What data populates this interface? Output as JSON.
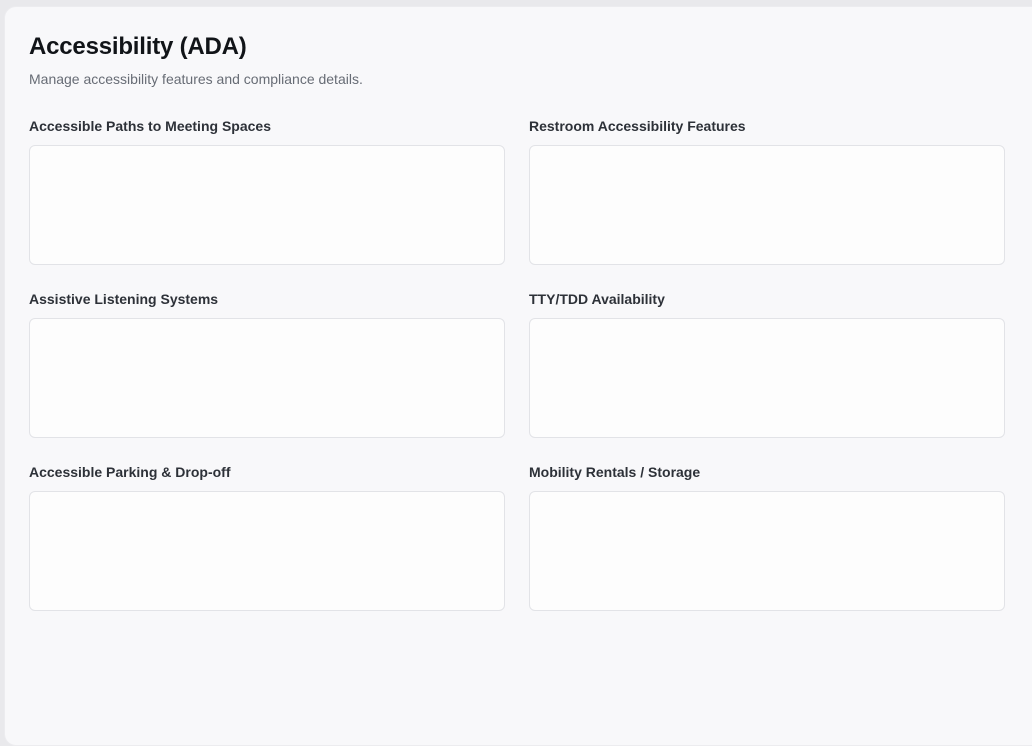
{
  "header": {
    "title": "Accessibility (ADA)",
    "subtitle": "Manage accessibility features and compliance details."
  },
  "fields": [
    {
      "label": "Accessible Paths to Meeting Spaces",
      "value": ""
    },
    {
      "label": "Restroom Accessibility Features",
      "value": ""
    },
    {
      "label": "Assistive Listening Systems",
      "value": ""
    },
    {
      "label": "TTY/TDD Availability",
      "value": ""
    },
    {
      "label": "Accessible Parking & Drop-off",
      "value": ""
    },
    {
      "label": "Mobility Rentals / Storage",
      "value": ""
    }
  ]
}
